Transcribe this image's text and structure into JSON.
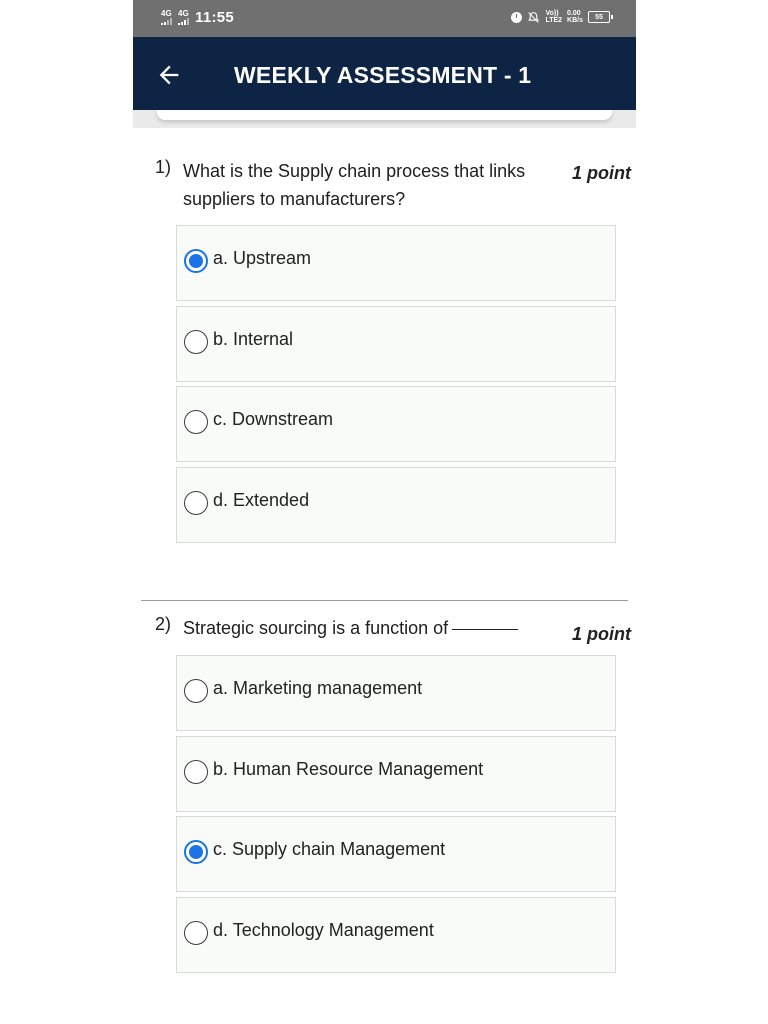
{
  "status_bar": {
    "net_1": "4G",
    "net_2": "4G",
    "time": "11:55",
    "volte_top": "Vo))",
    "volte_bottom": "LTE2",
    "speed_top": "0.00",
    "speed_bottom": "KB/s",
    "battery": "55"
  },
  "app_bar": {
    "back_icon": "arrow-left-icon",
    "title": "WEEKLY ASSESSMENT - 1"
  },
  "questions": [
    {
      "number": "1)",
      "text": "What is the Supply chain process that links suppliers to manufacturers?",
      "points": "1 point",
      "options": [
        {
          "label": "a. Upstream",
          "selected": true
        },
        {
          "label": "b. Internal",
          "selected": false
        },
        {
          "label": "c. Downstream",
          "selected": false
        },
        {
          "label": "d. Extended",
          "selected": false
        }
      ]
    },
    {
      "number": "2)",
      "text": "Strategic sourcing is a function of",
      "points": "1 point",
      "options": [
        {
          "label": "a. Marketing management",
          "selected": false
        },
        {
          "label": "b. Human Resource Management",
          "selected": false
        },
        {
          "label": "c. Supply chain Management",
          "selected": true
        },
        {
          "label": "d. Technology Management",
          "selected": false
        }
      ]
    }
  ],
  "colors": {
    "app_bar": "#0d2445",
    "status_bar": "#707070",
    "radio_selected": "#1a73e8",
    "option_bg": "#f8fbf8"
  }
}
